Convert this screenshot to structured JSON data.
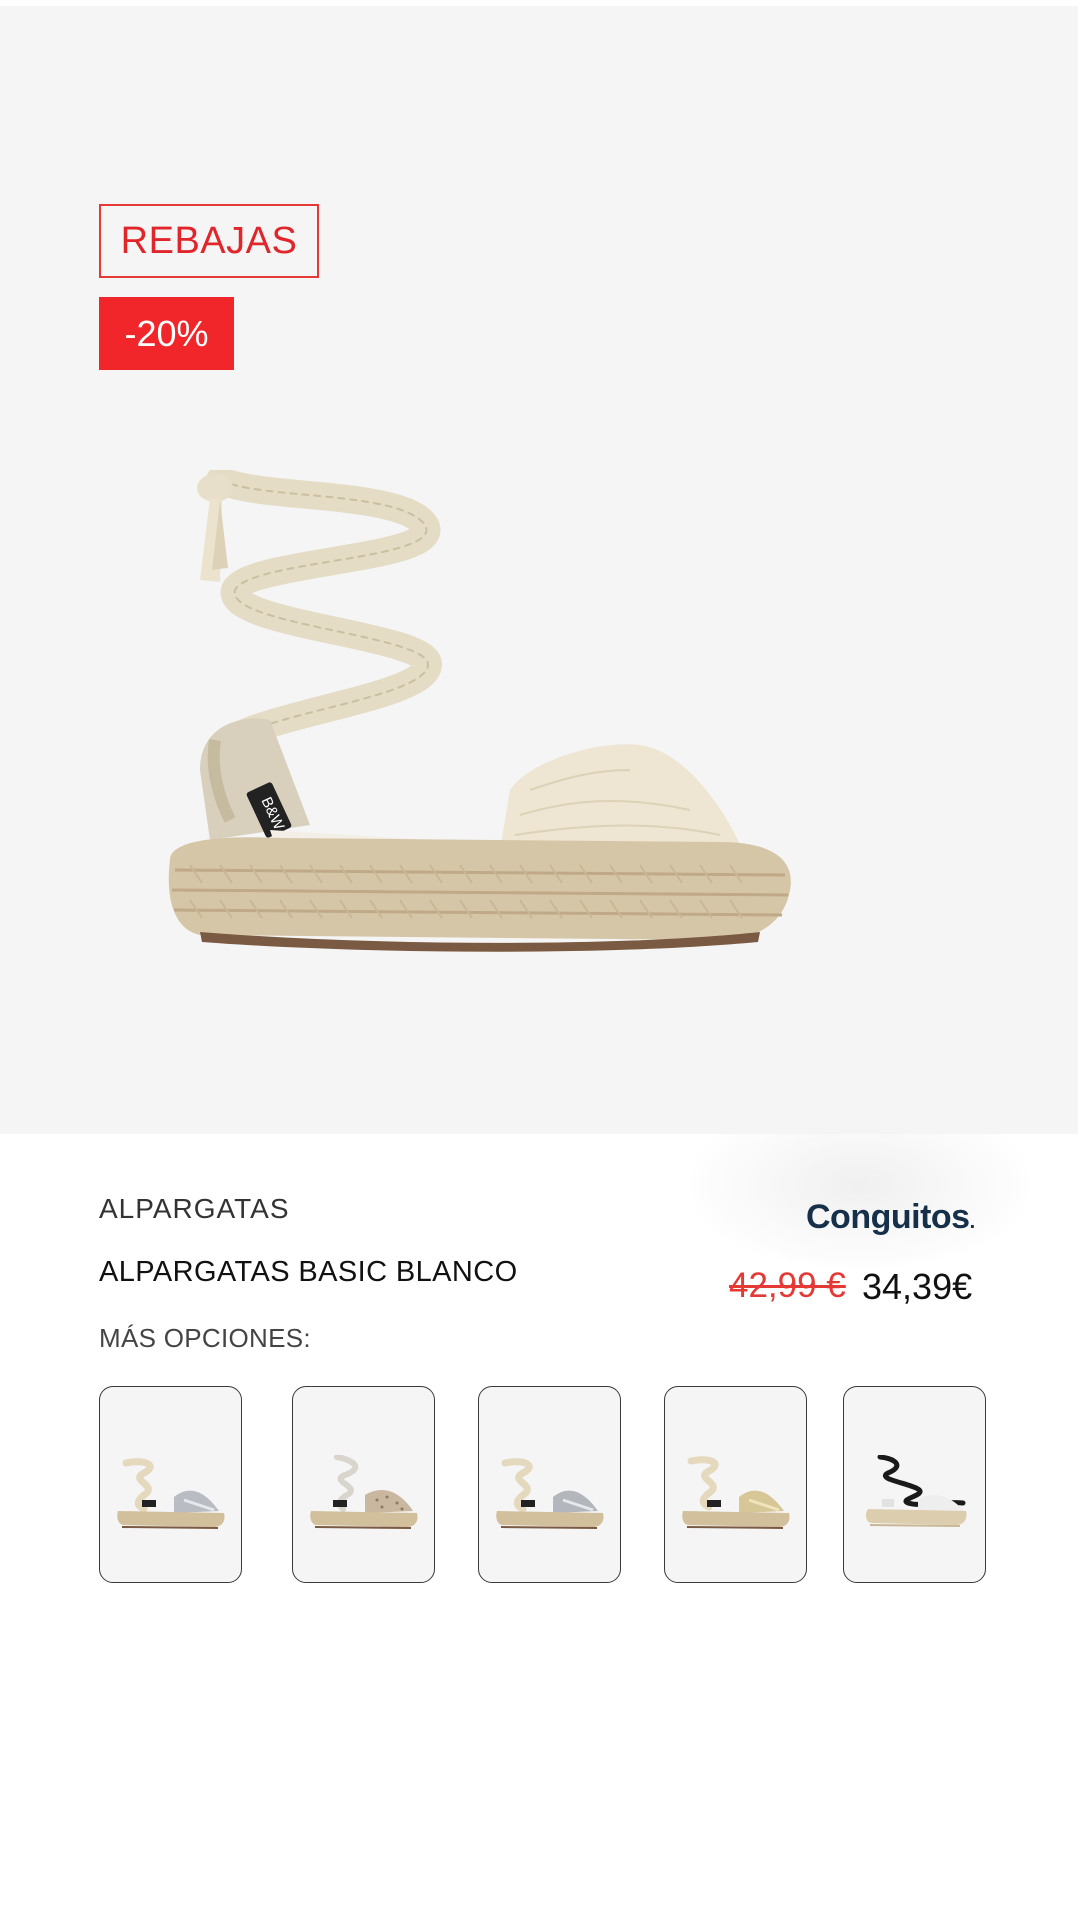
{
  "badges": {
    "sale": "REBAJAS",
    "discount": "-20%"
  },
  "product": {
    "category": "ALPARGATAS",
    "name": "ALPARGATAS BASIC BLANCO",
    "brand": "Conguitos",
    "brand_dot": ".",
    "price_old": "42,99 €",
    "price_new": "34,39€",
    "image_icon": "espadrille-image",
    "tag_text": "B&W"
  },
  "options": {
    "label": "MÁS OPCIONES:",
    "items": [
      {
        "icon": "espadrille-silver-thumbnail"
      },
      {
        "icon": "espadrille-glitter-thumbnail"
      },
      {
        "icon": "espadrille-silver-thumbnail"
      },
      {
        "icon": "espadrille-gold-thumbnail"
      },
      {
        "icon": "espadrille-black-laces-thumbnail"
      }
    ]
  },
  "colors": {
    "sale_red": "#e53935",
    "brand_navy": "#17304a",
    "hero_bg": "#f5f5f5"
  }
}
